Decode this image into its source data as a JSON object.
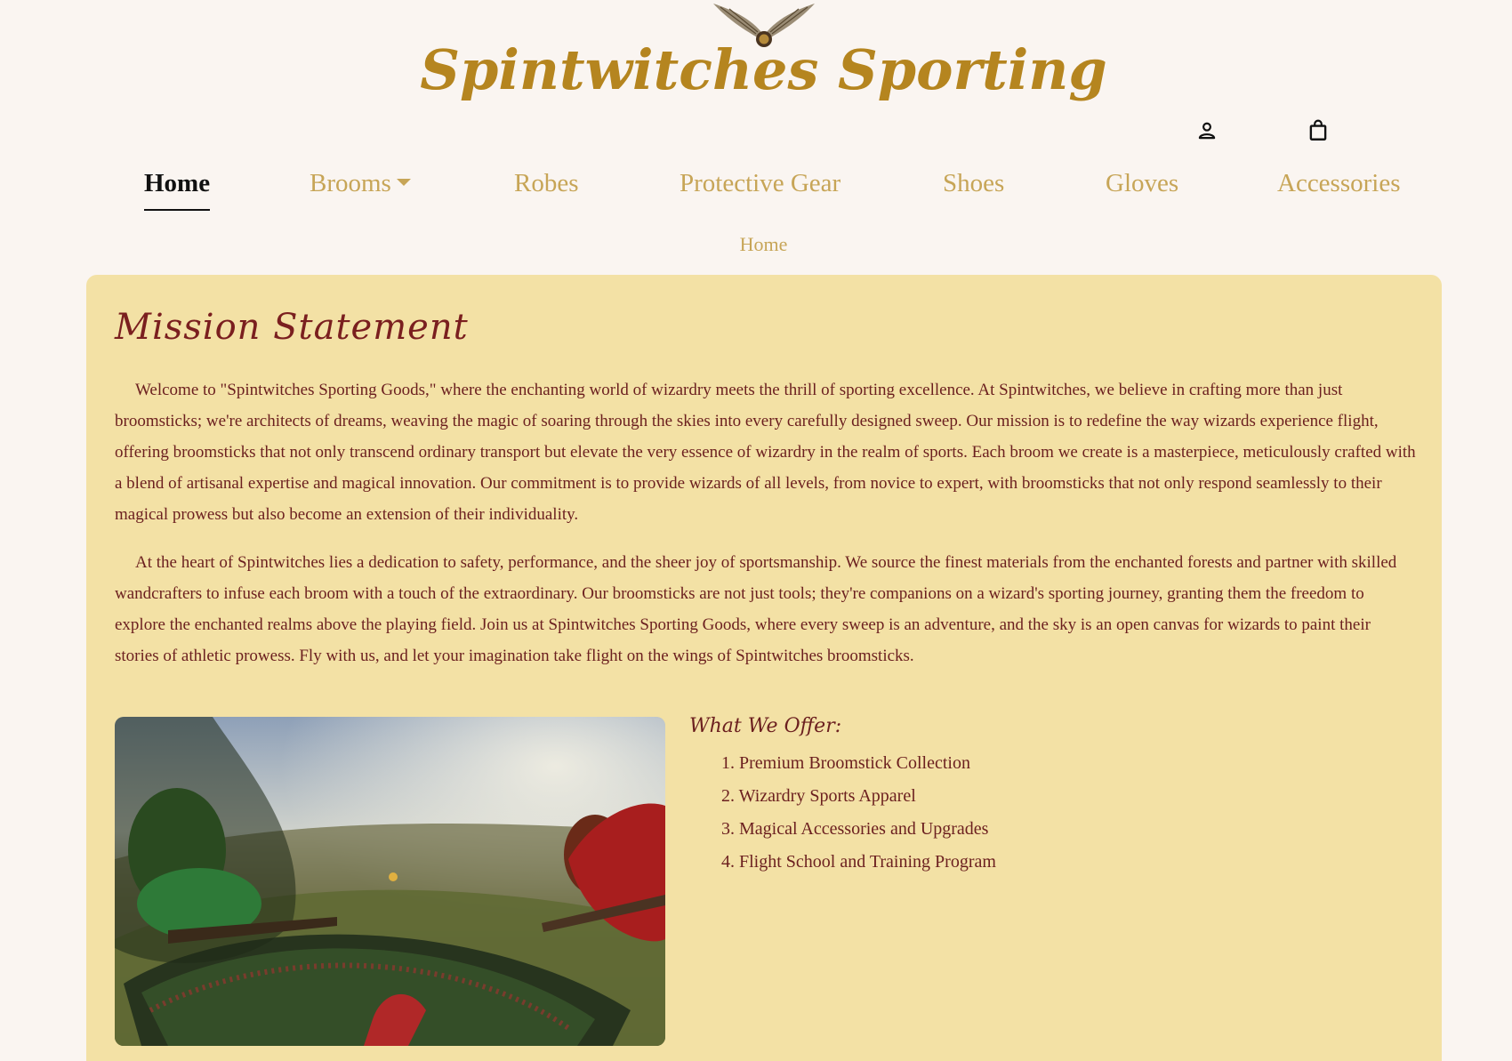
{
  "brand": {
    "name": "Spintwitches Sporting",
    "logo_icon": "golden-snitch-icon",
    "color": "#b5851f"
  },
  "header_icons": {
    "account_icon": "person-icon",
    "cart_icon": "shopping-bag-icon"
  },
  "nav": {
    "items": [
      {
        "label": "Home",
        "active": true
      },
      {
        "label": "Brooms",
        "dropdown": true
      },
      {
        "label": "Robes"
      },
      {
        "label": "Protective Gear"
      },
      {
        "label": "Shoes"
      },
      {
        "label": "Gloves"
      },
      {
        "label": "Accessories"
      }
    ]
  },
  "breadcrumb": "Home",
  "main": {
    "title": "Mission Statement",
    "paragraphs": [
      "Welcome to \"Spintwitches Sporting Goods,\" where the enchanting world of wizardry meets the thrill of sporting excellence. At Spintwitches, we believe in crafting more than just broomsticks; we're architects of dreams, weaving the magic of soaring through the skies into every carefully designed sweep. Our mission is to redefine the way wizards experience flight, offering broomsticks that not only transcend ordinary transport but elevate the very essence of wizardry in the realm of sports. Each broom we create is a masterpiece, meticulously crafted with a blend of artisanal expertise and magical innovation. Our commitment is to provide wizards of all levels, from novice to expert, with broomsticks that not only respond seamlessly to their magical prowess but also become an extension of their individuality.",
      "At the heart of Spintwitches lies a dedication to safety, performance, and the sheer joy of sportsmanship. We source the finest materials from the enchanted forests and partner with skilled wandcrafters to infuse each broom with a touch of the extraordinary. Our broomsticks are not just tools; they're companions on a wizard's sporting journey, granting them the freedom to explore the enchanted realms above the playing field. Join us at Spintwitches Sporting Goods, where every sweep is an adventure, and the sky is an open canvas for wizards to paint their stories of athletic prowess. Fly with us, and let your imagination take flight on the wings of Spintwitches broomsticks."
    ],
    "offer_title": "What We Offer:",
    "offers": [
      "1. Premium Broomstick Collection",
      "2. Wizardry Sports Apparel",
      "3. Magical Accessories and Upgrades",
      "4. Flight School and Training Program"
    ]
  },
  "colors": {
    "page_bg": "#faf5f1",
    "card_bg": "#f3e1a5",
    "text_maroon": "#6b1f1f",
    "nav_gold": "#c7a557"
  }
}
